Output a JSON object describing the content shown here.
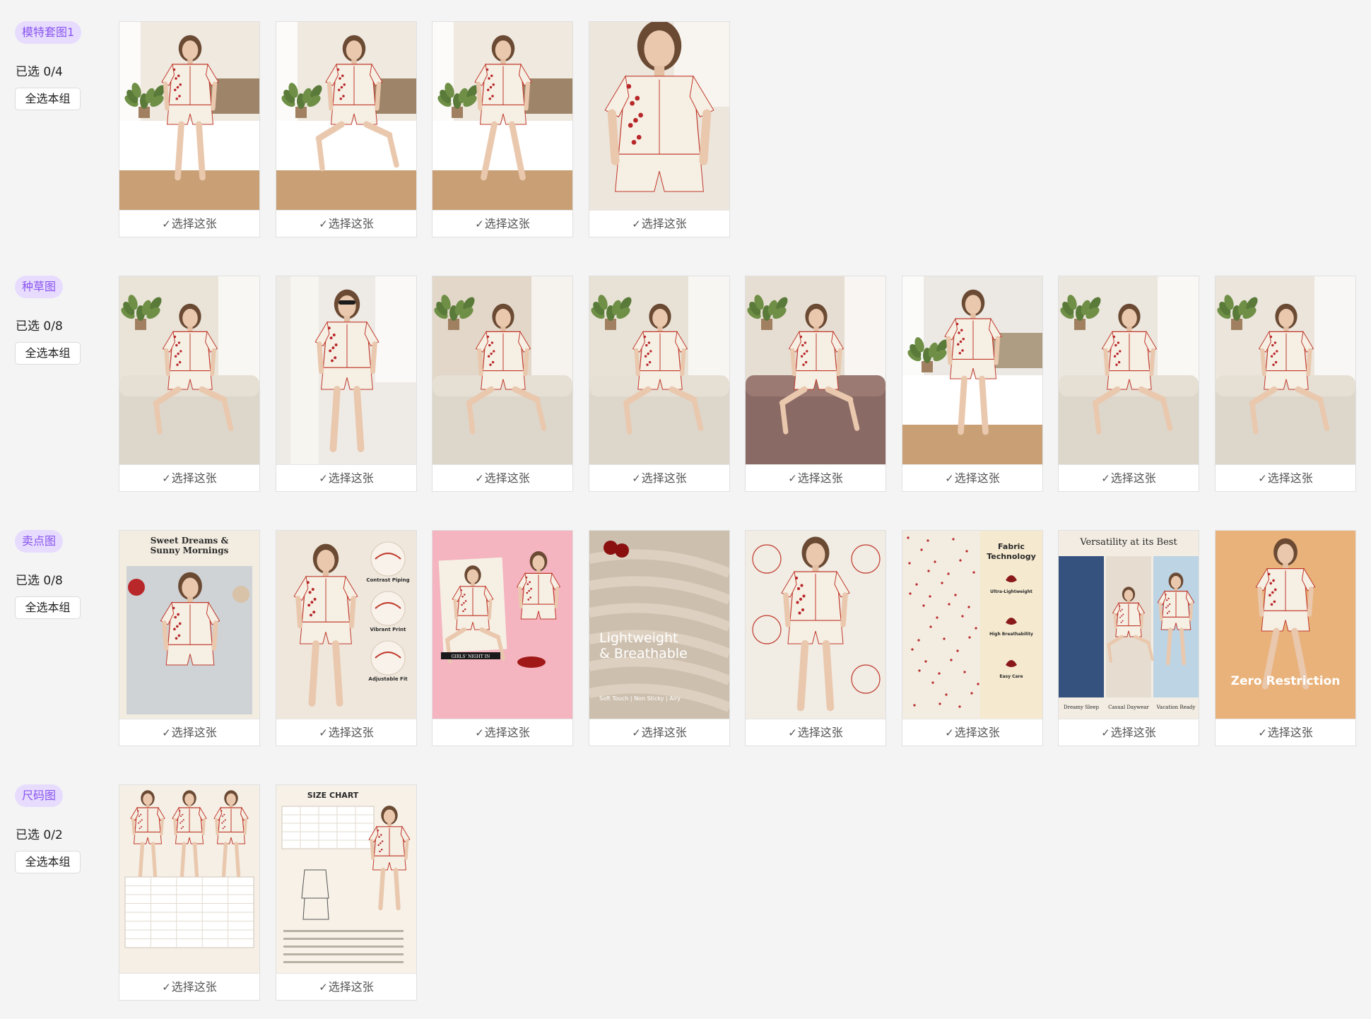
{
  "labels": {
    "select_all": "全选本组",
    "pick": "选择这张",
    "check_glyph": "✓"
  },
  "colors": {
    "tag_bg": "#e7dcfd",
    "tag_text": "#8a55f0",
    "background": "#f4f4f5",
    "piping_red": "#c0392b"
  },
  "groups": [
    {
      "tag": "模特套图1",
      "count_text": "已选 0/4",
      "images": [
        {
          "scene": "bed-standing",
          "bg": "#efe9e0",
          "accent": "#8a6a4a"
        },
        {
          "scene": "bed-sitting",
          "bg": "#efe9e0",
          "accent": "#8a6a4a"
        },
        {
          "scene": "bed-walking",
          "bg": "#efe9e0",
          "accent": "#8a6a4a"
        },
        {
          "scene": "closeup",
          "bg": "#ede6dc",
          "accent": "#6b4a34"
        }
      ]
    },
    {
      "tag": "种草图",
      "count_text": "已选 0/8",
      "images": [
        {
          "scene": "sofa",
          "bg": "#e9e3d8",
          "accent": "#b08a5a"
        },
        {
          "scene": "standing-sunglasses",
          "bg": "#eeebe6",
          "accent": "#2c2c2c"
        },
        {
          "scene": "sofa-cardigan",
          "bg": "#e2d7c8",
          "accent": "#9a7a5a"
        },
        {
          "scene": "armchair-reading",
          "bg": "#e8e2d6",
          "accent": "#7a5a3a"
        },
        {
          "scene": "armchair-pink",
          "bg": "#e7ded3",
          "accent": "#8a6a5a"
        },
        {
          "scene": "bed-mug",
          "bg": "#ece9e4",
          "accent": "#a08a6a"
        },
        {
          "scene": "sofa-mug",
          "bg": "#ebe6de",
          "accent": "#6a4a3a"
        },
        {
          "scene": "sofa-book",
          "bg": "#ebe5dc",
          "accent": "#b08a5a"
        }
      ]
    },
    {
      "tag": "卖点图",
      "count_text": "已选 0/8",
      "images": [
        {
          "scene": "flatlay",
          "bg": "#f3ede1",
          "accent": "#c0392b"
        },
        {
          "scene": "features-circles",
          "bg": "#efe7dc",
          "accent": "#c0392b"
        },
        {
          "scene": "pink-collage",
          "bg": "#f4b4c0",
          "accent": "#c0392b"
        },
        {
          "scene": "fabric-text",
          "bg": "#cdbfae",
          "accent": "#7a1010"
        },
        {
          "scene": "callouts",
          "bg": "#f1ece4",
          "accent": "#c0392b"
        },
        {
          "scene": "fabric-technology",
          "bg": "#f5ead0",
          "accent": "#8a1a1a"
        },
        {
          "scene": "versatility",
          "bg": "#f2ece2",
          "accent": "#4a6a9a"
        },
        {
          "scene": "jump",
          "bg": "#e9b27a",
          "accent": "#ffffff"
        }
      ]
    },
    {
      "tag": "尺码图",
      "count_text": "已选 0/2",
      "images": [
        {
          "scene": "size-models",
          "bg": "#f5efe6",
          "accent": "#8a6a4a"
        },
        {
          "scene": "size-chart",
          "bg": "#f7f1e8",
          "accent": "#3a3a3a"
        }
      ]
    }
  ]
}
